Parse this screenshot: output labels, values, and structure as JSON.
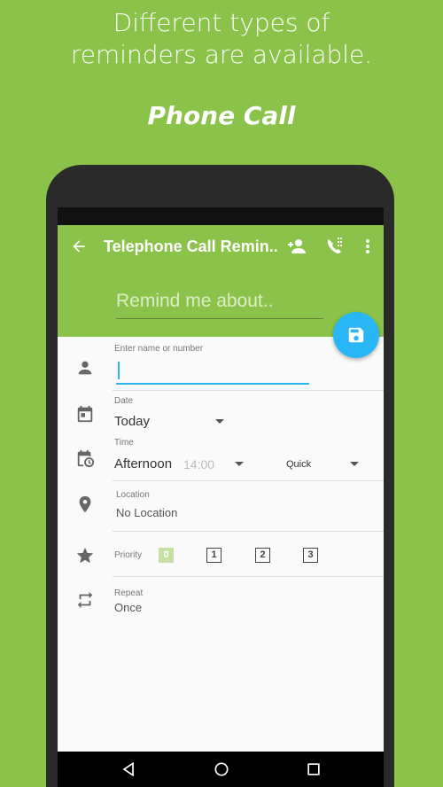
{
  "promo": {
    "headline_line1": "Different types of",
    "headline_line2": "reminders are available.",
    "subtitle": "Phone Call"
  },
  "appbar": {
    "title": "Telephone Call Remin...",
    "remind_placeholder": "Remind me about.."
  },
  "form": {
    "name_label": "Enter name or number",
    "date_label": "Date",
    "date_value": "Today",
    "time_label": "Time",
    "time_value": "Afternoon",
    "time_clock": "14:00",
    "quick_label": "Quick",
    "location_label": "Location",
    "location_value": "No Location",
    "priority_label": "Priority",
    "priority_options": [
      "0",
      "1",
      "2",
      "3"
    ],
    "priority_selected": "0",
    "repeat_label": "Repeat",
    "repeat_value": "Once"
  },
  "colors": {
    "background": "#8bc34a",
    "accent": "#29b6f6",
    "priority_active": "#c5e1a5"
  },
  "icons": {
    "back": "arrow-back-icon",
    "contact": "add-contact-icon",
    "dialpad": "phone-dialpad-icon",
    "more": "more-vert-icon",
    "save": "save-icon",
    "person": "person-icon",
    "date": "calendar-icon",
    "time": "calendar-clock-icon",
    "location": "location-pin-icon",
    "priority": "star-icon",
    "repeat": "repeat-icon"
  }
}
